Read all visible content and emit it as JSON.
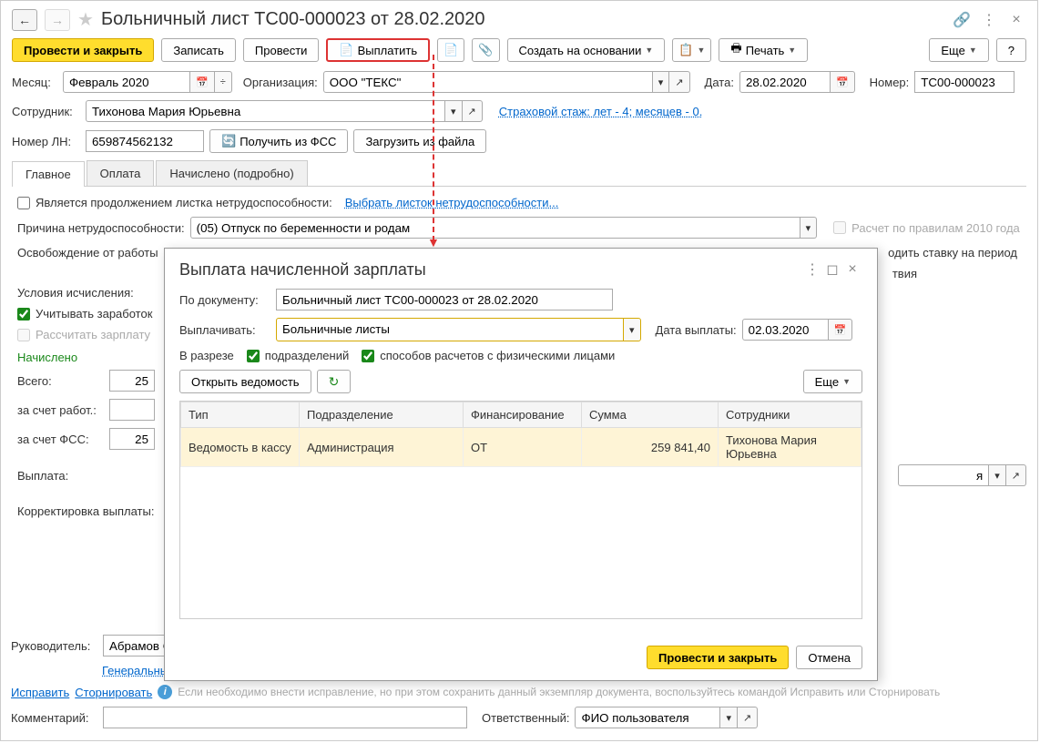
{
  "title": "Больничный лист ТС00-000023 от 28.02.2020",
  "toolbar": {
    "post_close": "Провести и закрыть",
    "save": "Записать",
    "post": "Провести",
    "pay": "Выплатить",
    "create_based": "Создать на основании",
    "print": "Печать",
    "more": "Еще",
    "help": "?"
  },
  "form": {
    "month_lbl": "Месяц:",
    "month_val": "Февраль 2020",
    "org_lbl": "Организация:",
    "org_val": "ООО \"ТЕКС\"",
    "date_lbl": "Дата:",
    "date_val": "28.02.2020",
    "num_lbl": "Номер:",
    "num_val": "ТС00-000023",
    "emp_lbl": "Сотрудник:",
    "emp_val": "Тихонова Мария Юрьевна",
    "stazh_link": "Страховой стаж: лет - 4; месяцев - 0.",
    "ln_lbl": "Номер ЛН:",
    "ln_val": "659874562132",
    "get_fss": "Получить из ФСС",
    "load_file": "Загрузить из файла"
  },
  "tabs": {
    "t1": "Главное",
    "t2": "Оплата",
    "t3": "Начислено (подробно)"
  },
  "main_tab": {
    "continuation_lbl": "Является продолжением листка нетрудоспособности:",
    "select_sheet": "Выбрать листок нетрудоспособности...",
    "reason_lbl": "Причина нетрудоспособности:",
    "reason_val": "(05) Отпуск по беременности и родам",
    "rules2010_lbl": "Расчет по правилам 2010 года",
    "release_lbl": "Освобождение от работы",
    "rate_lbl": "одить ставку на период",
    "absence_lbl": "твия",
    "conditions_lbl": "Условия исчисления:",
    "consider_earn": "Учитывать заработок",
    "calc_salary": "Рассчитать зарплату",
    "accrued_lbl": "Начислено",
    "total_lbl": "Всего:",
    "total_val": "25",
    "employer_lbl": "за счет работ.:",
    "employer_val": "",
    "fss_lbl": "за счет ФСС:",
    "fss_val": "25",
    "payment_lbl": "Выплата:",
    "payment_end": "я",
    "corr_lbl": "Корректировка выплаты:"
  },
  "modal": {
    "title": "Выплата начисленной зарплаты",
    "doc_lbl": "По документу:",
    "doc_val": "Больничный лист ТС00-000023 от 28.02.2020",
    "pay_lbl": "Выплачивать:",
    "pay_val": "Больничные листы",
    "paydate_lbl": "Дата выплаты:",
    "paydate_val": "02.03.2020",
    "section_lbl": "В разрезе",
    "cb_dept": "подразделений",
    "cb_method": "способов расчетов с физическими лицами",
    "open_list": "Открыть ведомость",
    "more": "Еще",
    "th_type": "Тип",
    "th_dept": "Подразделение",
    "th_fin": "Финансирование",
    "th_sum": "Сумма",
    "th_emp": "Сотрудники",
    "row": {
      "type": "Ведомость в кассу",
      "dept": "Администрация",
      "fin": "ОТ",
      "sum": "259 841,40",
      "emp": "Тихонова Мария Юрьевна"
    },
    "post_close": "Провести  и закрыть",
    "cancel": "Отмена"
  },
  "footer": {
    "head_lbl": "Руководитель:",
    "head_val": "Абрамов С",
    "position_link": "Генеральны",
    "fix": "Исправить",
    "storno": "Сторнировать",
    "info_text": "Если необходимо внести исправление, но при этом сохранить данный экземпляр документа, воспользуйтесь командой Исправить или Сторнировать",
    "comment_lbl": "Комментарий:",
    "resp_lbl": "Ответственный:",
    "resp_val": "ФИО пользователя"
  }
}
